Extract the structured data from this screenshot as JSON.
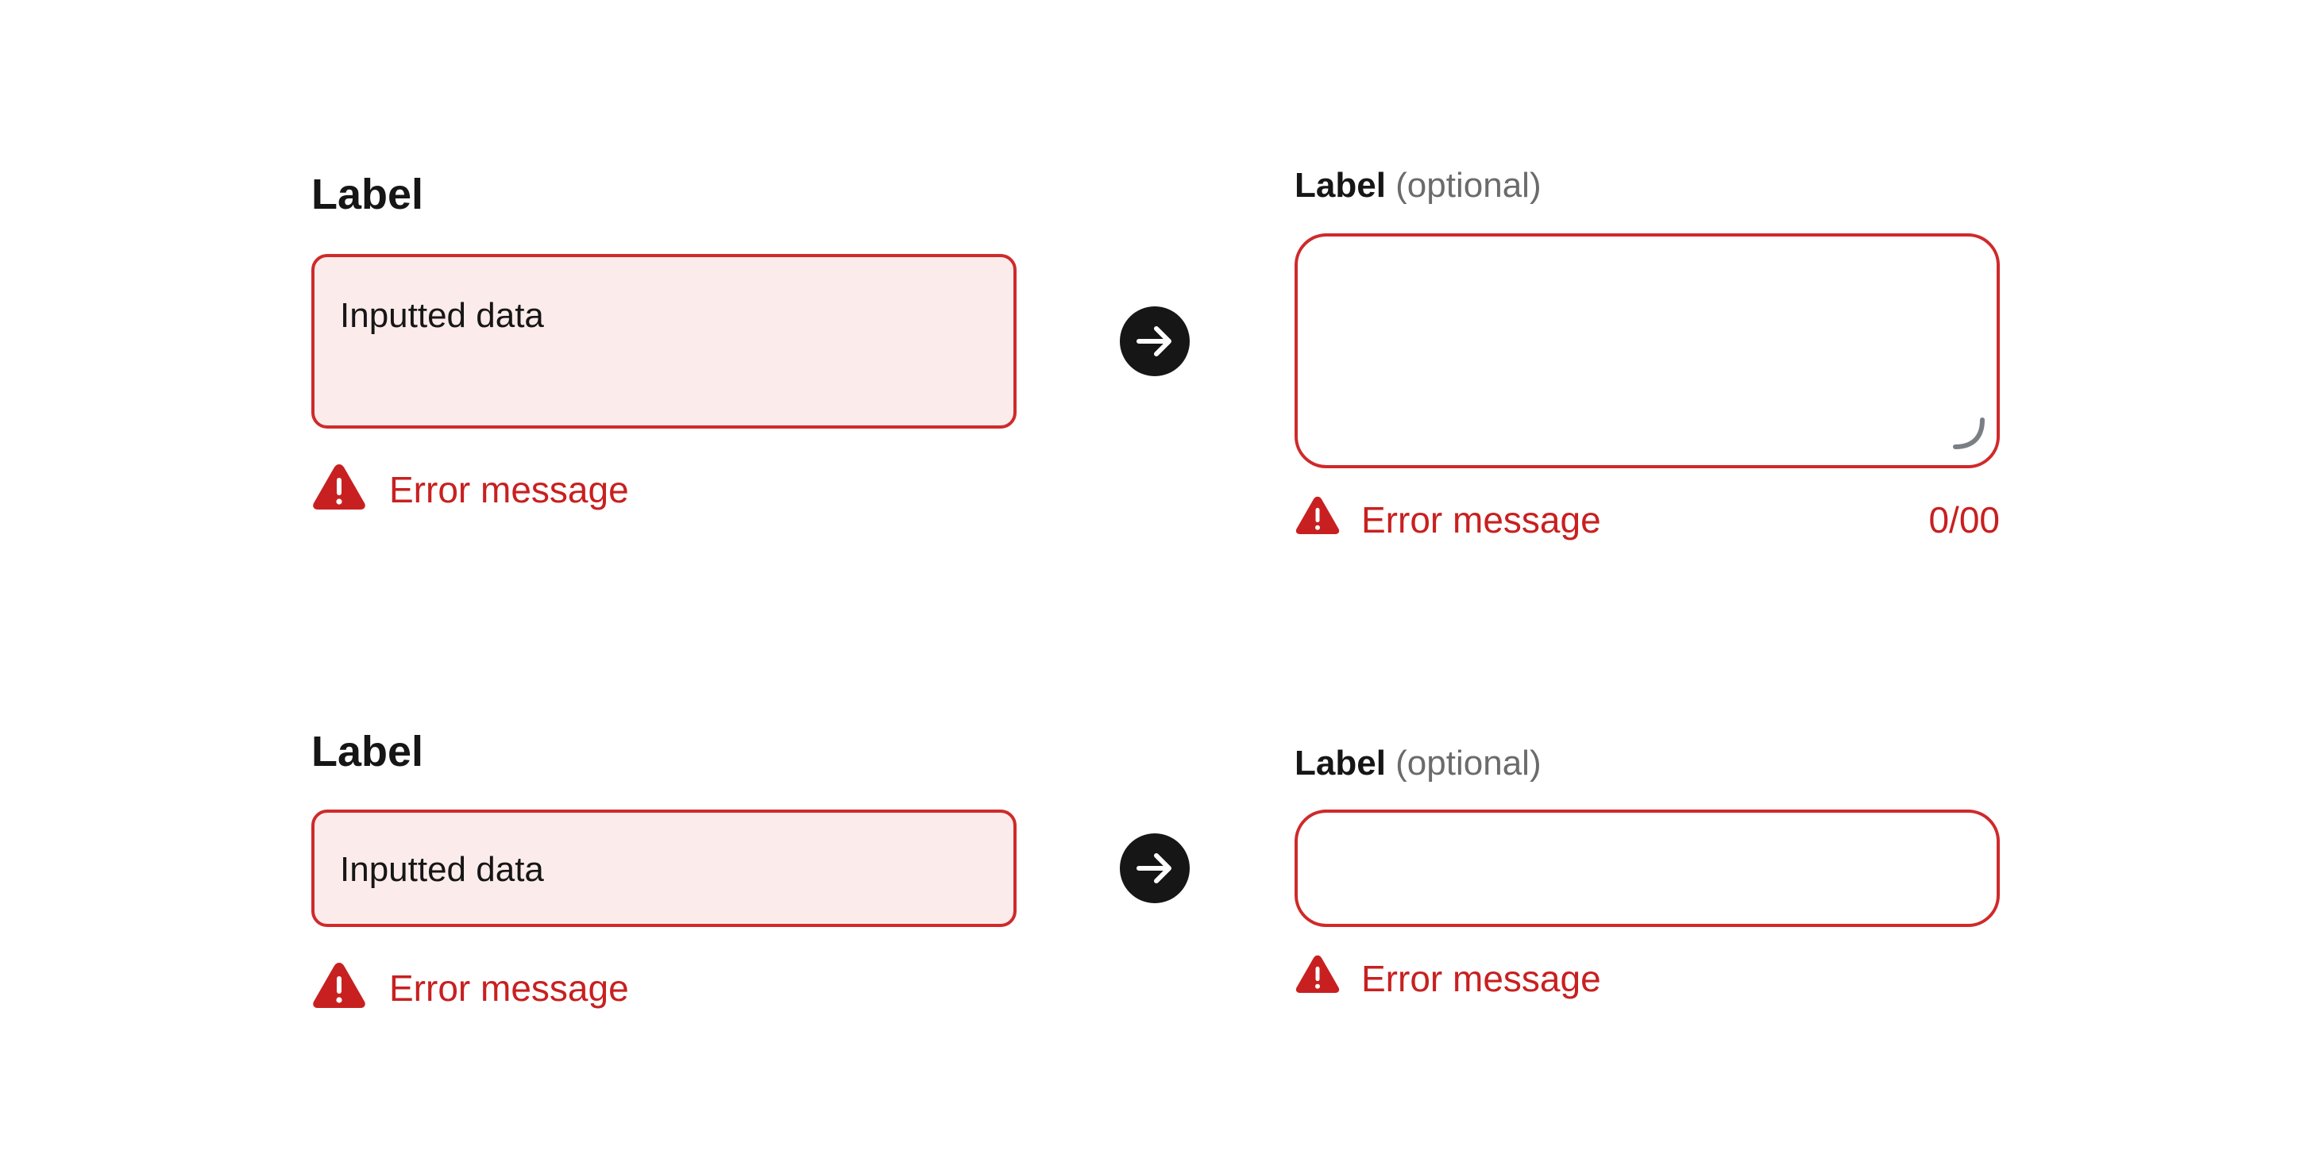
{
  "colors": {
    "error": "#c82020",
    "border_error": "#cf2a2a",
    "old_fill": "#fbeceb",
    "text": "#161616",
    "muted": "#6b6b6b"
  },
  "old_textarea": {
    "label": "Label",
    "value": "Inputted data",
    "error": "Error message",
    "icon": "warning-triangle-icon"
  },
  "new_textarea": {
    "label": "Label",
    "optional": "(optional)",
    "error": "Error message",
    "counter": "0/00",
    "icon": "warning-triangle-icon",
    "resize_icon": "resize-handle-icon"
  },
  "old_input": {
    "label": "Label",
    "value": "Inputted data",
    "error": "Error message",
    "icon": "warning-triangle-icon"
  },
  "new_input": {
    "label": "Label",
    "optional": "(optional)",
    "error": "Error message",
    "icon": "warning-triangle-icon"
  },
  "transition_icon": "arrow-right-icon"
}
